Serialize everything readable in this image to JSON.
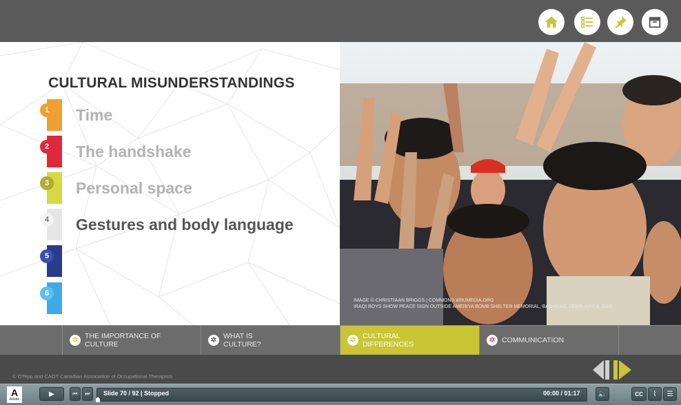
{
  "topbar": {
    "buttons": [
      {
        "name": "home-icon",
        "label": "Home"
      },
      {
        "name": "menu-list-icon",
        "label": "Menu"
      },
      {
        "name": "pin-icon",
        "label": "Pin"
      },
      {
        "name": "archive-icon",
        "label": "Resources"
      }
    ]
  },
  "slide": {
    "heading": "CULTURAL MISUNDERSTANDINGS",
    "items": [
      {
        "num": "1",
        "label": "Time",
        "color": "#f0a030",
        "text_color": "#b3b3b3"
      },
      {
        "num": "2",
        "label": "The handshake",
        "color": "#e0283c",
        "text_color": "#b3b3b3"
      },
      {
        "num": "3",
        "label": "Personal space",
        "color": "#c8c63a",
        "text_color": "#b3b3b3"
      },
      {
        "num": "4",
        "label": "Gestures and body language",
        "color": "#e6e6e6",
        "text_color": "#555555"
      },
      {
        "num": "5",
        "label": "",
        "color": "#2a3a8c",
        "text_color": "#555555"
      },
      {
        "num": "6",
        "label": "",
        "color": "#3fa8e8",
        "text_color": "#555555"
      }
    ],
    "photo_credit_line1": "IMAGE © CHRISTIAAN BRIGGS | COMMONS.WIKIMEDIA.ORG",
    "photo_credit_line2": "IRAQI BOYS SHOW PEACE SIGN OUTSIDE AMERIYA BOMB SHELTER MEMORIAL, BAGHDAD, FEBRUARY 8, 2005"
  },
  "sections": [
    {
      "label_line1": "THE IMPORTANCE OF",
      "label_line2": "CULTURE",
      "icon": "✲",
      "icon_color": "#c9c534",
      "active": false
    },
    {
      "label_line1": "WHAT IS",
      "label_line2": "CULTURE?",
      "icon": "✲",
      "icon_color": "#333333",
      "active": false
    },
    {
      "label_line1": "CULTURAL",
      "label_line2": "DIFFERENCES",
      "icon": "✲",
      "icon_color": "#c9c534",
      "active": true
    },
    {
      "label_line1": "COMMUNICATION",
      "label_line2": "",
      "icon": "✲",
      "icon_color": "#e0283c",
      "active": false
    }
  ],
  "footer": {
    "copyright": "© OTepp and CAOT Canadian Association of Occupational Therapists"
  },
  "player": {
    "slide_info": "Slide 70 / 92 | Stopped",
    "time": "00:00 / 01:17",
    "progress": 0.0,
    "logo_text": "Adobe",
    "logo_mark": "A",
    "cc_label": "CC"
  },
  "colors": {
    "accent": "#c9c534",
    "topbar": "#5a5a5a"
  }
}
